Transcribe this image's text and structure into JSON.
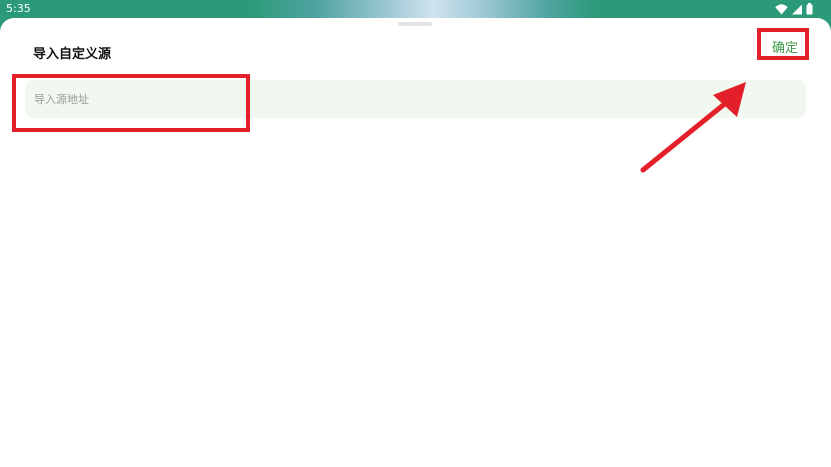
{
  "status_bar": {
    "time": "5:35",
    "icons": [
      "wifi-icon",
      "signal-icon",
      "battery-icon"
    ]
  },
  "sheet": {
    "title": "导入自定义源",
    "confirm_label": "确定",
    "input": {
      "placeholder": "导入源地址",
      "value": ""
    }
  },
  "colors": {
    "accent": "#3f9a4a",
    "annotation": "#e3202a",
    "input_bg": "#f1f8ef",
    "status_bar_bg": "#2a9a78"
  }
}
